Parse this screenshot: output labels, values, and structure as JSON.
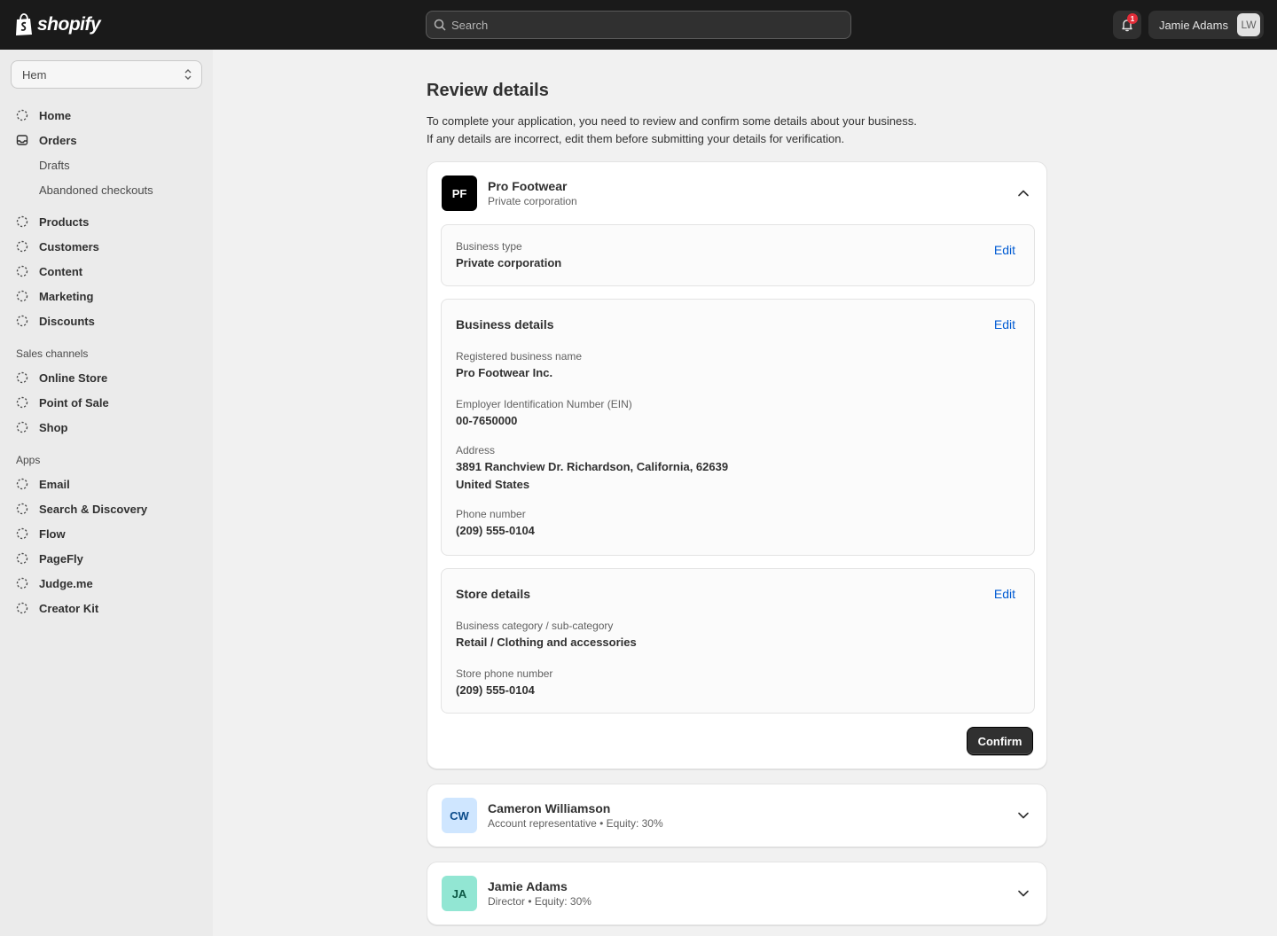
{
  "topbar": {
    "logo_text": "shopify",
    "search_placeholder": "Search",
    "notification_count": "1",
    "user_name": "Jamie Adams",
    "user_initials": "LW"
  },
  "sidebar": {
    "store": "Hem",
    "main_items": [
      {
        "label": "Home"
      },
      {
        "label": "Orders"
      }
    ],
    "order_sub_items": [
      {
        "label": "Drafts"
      },
      {
        "label": "Abandoned checkouts"
      }
    ],
    "more_items": [
      {
        "label": "Products"
      },
      {
        "label": "Customers"
      },
      {
        "label": "Content"
      },
      {
        "label": "Marketing"
      },
      {
        "label": "Discounts"
      }
    ],
    "sales_channels_heading": "Sales channels",
    "sales_channels": [
      {
        "label": "Online Store"
      },
      {
        "label": "Point of Sale"
      },
      {
        "label": "Shop"
      }
    ],
    "apps_heading": "Apps",
    "apps": [
      {
        "label": "Email"
      },
      {
        "label": "Search & Discovery"
      },
      {
        "label": "Flow"
      },
      {
        "label": "PageFly"
      },
      {
        "label": "Judge.me"
      },
      {
        "label": "Creator Kit"
      }
    ]
  },
  "main": {
    "title": "Review details",
    "description_line1": "To complete your application, you need to review and confirm some details about your business.",
    "description_line2": "If any details are incorrect, edit them before submitting your details for verification.",
    "business": {
      "initials": "PF",
      "name": "Pro Footwear",
      "subtitle": "Private corporation",
      "business_type": {
        "label": "Business type",
        "value": "Private corporation",
        "edit": "Edit"
      },
      "business_details": {
        "title": "Business details",
        "edit": "Edit",
        "registered_name_label": "Registered business name",
        "registered_name": "Pro Footwear Inc.",
        "ein_label": "Employer Identification Number (EIN)",
        "ein": "00-7650000",
        "address_label": "Address",
        "address_line1": "3891 Ranchview Dr. Richardson, California, 62639",
        "address_line2": "United States",
        "phone_label": "Phone number",
        "phone": "(209) 555-0104"
      },
      "store_details": {
        "title": "Store details",
        "edit": "Edit",
        "category_label": "Business category / sub-category",
        "category": "Retail / Clothing and accessories",
        "store_phone_label": "Store phone number",
        "store_phone": "(209) 555-0104"
      },
      "confirm_label": "Confirm"
    },
    "people": [
      {
        "initials": "CW",
        "name": "Cameron Williamson",
        "subtitle": "Account representative • Equity: 30%",
        "color": "#cfe6ff",
        "text_color": "#0a4b8a"
      },
      {
        "initials": "JA",
        "name": "Jamie Adams",
        "subtitle": "Director • Equity: 30%",
        "color": "#92e6d3",
        "text_color": "#0c5845"
      }
    ]
  },
  "colors": {
    "topbar_bg": "#1a1a1a",
    "link": "#005bd3",
    "primary_button": "#303030",
    "notification_badge": "#e22c38"
  }
}
